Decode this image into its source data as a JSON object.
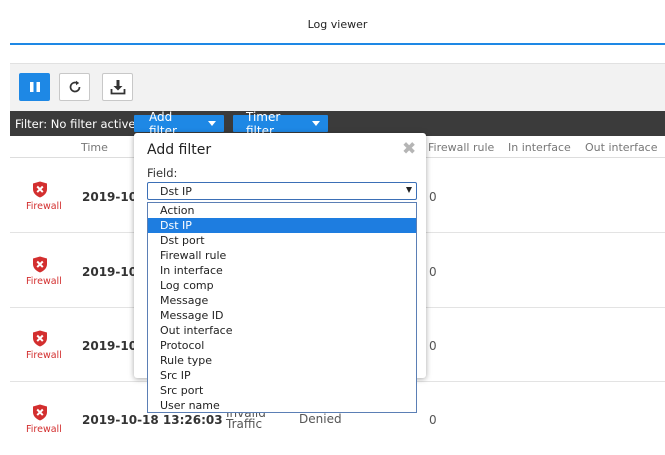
{
  "window": {
    "title": "Log viewer"
  },
  "toolbar": {
    "pause_icon": "pause-icon",
    "refresh_icon": "refresh-icon",
    "download_icon": "download-icon"
  },
  "filterbar": {
    "label": "Filter: No filter active",
    "add_filter": "Add filter",
    "timer_filter": "Timer filter"
  },
  "table": {
    "columns": [
      "Time",
      "Firewall rule",
      "In interface",
      "Out interface"
    ],
    "rows": [
      {
        "module": "Firewall",
        "time": "2019-10-1",
        "firewall_rule": "0"
      },
      {
        "module": "Firewall",
        "time": "2019-10-1",
        "firewall_rule": "0"
      },
      {
        "module": "Firewall",
        "time": "2019-10-1",
        "firewall_rule": "0"
      },
      {
        "module": "Firewall",
        "time": "2019-10-18 13:26:03",
        "reason_line1": "Invalid",
        "reason_line2": "Traffic",
        "status": "Denied",
        "firewall_rule": "0"
      }
    ]
  },
  "dialog": {
    "title": "Add filter",
    "field_label": "Field:",
    "field_value": "Dst IP",
    "options": [
      "Action",
      "Dst IP",
      "Dst port",
      "Firewall rule",
      "In interface",
      "Log comp",
      "Message",
      "Message ID",
      "Out interface",
      "Protocol",
      "Rule type",
      "Src IP",
      "Src port",
      "User name"
    ],
    "selected_index": 1
  },
  "colors": {
    "accent": "#1e88e5",
    "filter_bar": "#3b3b3b",
    "firewall_red": "#d32f2f",
    "selected_option": "#1e7de0"
  }
}
